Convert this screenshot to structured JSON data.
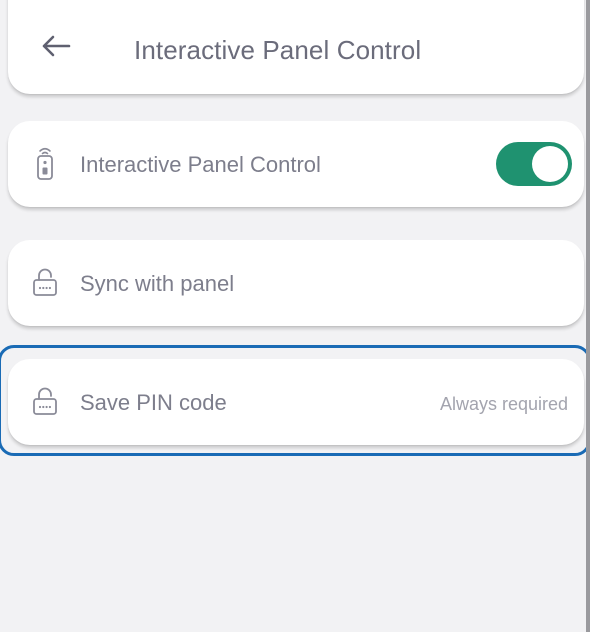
{
  "header": {
    "title": "Interactive Panel Control",
    "back_icon": "arrow-left-icon"
  },
  "settings": [
    {
      "icon": "remote-icon",
      "label": "Interactive Panel Control",
      "control": "toggle",
      "toggle_on": true
    },
    {
      "icon": "lock-pin-icon",
      "label": "Sync with panel"
    },
    {
      "icon": "lock-pin-icon",
      "label": "Save PIN code",
      "value": "Always required",
      "focused": true
    }
  ],
  "colors": {
    "background": "#f2f2f4",
    "card": "#ffffff",
    "toggle_on": "#1f9270",
    "text_primary": "#6b6c7b",
    "text_secondary": "#a3a4ae",
    "focus_outline": "#1a6bb5"
  }
}
